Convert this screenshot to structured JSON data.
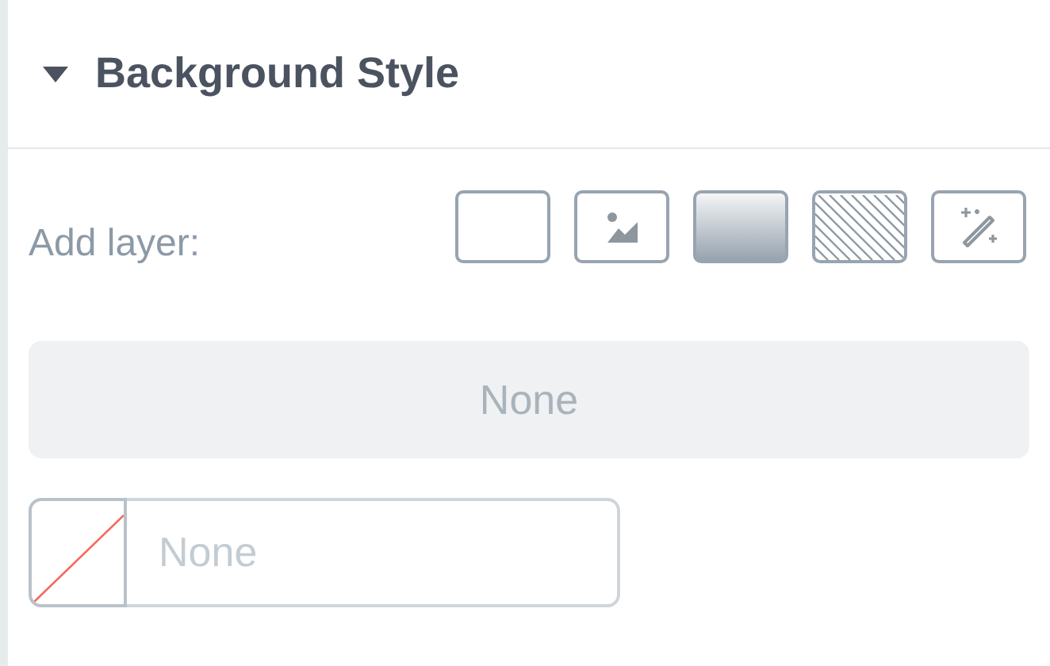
{
  "section": {
    "title": "Background Style",
    "expanded": true
  },
  "add_layer": {
    "label": "Add layer:",
    "types": [
      {
        "kind": "none"
      },
      {
        "kind": "image"
      },
      {
        "kind": "gradient"
      },
      {
        "kind": "pattern"
      },
      {
        "kind": "effect"
      }
    ]
  },
  "layers_list": {
    "empty_text": "None"
  },
  "color_field": {
    "placeholder": "None"
  }
}
